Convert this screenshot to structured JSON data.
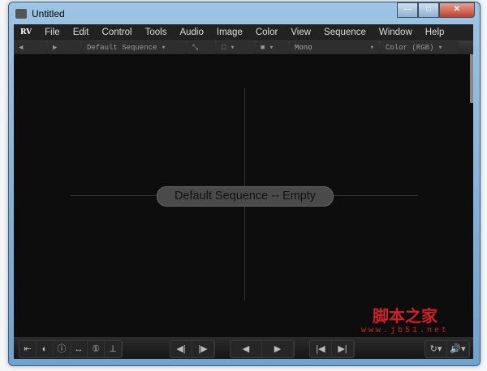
{
  "window": {
    "title": "Untitled",
    "min": "—",
    "max": "□",
    "close": "✕"
  },
  "menu": [
    "RV",
    "File",
    "Edit",
    "Control",
    "Tools",
    "Audio",
    "Image",
    "Color",
    "View",
    "Sequence",
    "Window",
    "Help"
  ],
  "toolbar": {
    "back": "◀",
    "forward": "▶",
    "sequence": "Default Sequence ▾",
    "wipe": "⤡",
    "frame": "□ ▾",
    "bg": "■ ▾",
    "channel": "Mono",
    "channel_arrow": "▾",
    "color": "Color (RGB) ▾"
  },
  "viewer": {
    "message": "Default Sequence -- Empty"
  },
  "watermark": {
    "cn": "脚本之家",
    "url": "www.jb51.net"
  },
  "bottom": {
    "left": [
      "⇤",
      "◐",
      "ⓘ",
      "↔",
      "①",
      "⊥"
    ],
    "step": [
      "◀|",
      "|▶"
    ],
    "play": [
      "◀",
      "▶"
    ],
    "ends": [
      "|◀",
      "▶|"
    ],
    "right": [
      "↻▾",
      "🔊▾"
    ]
  }
}
